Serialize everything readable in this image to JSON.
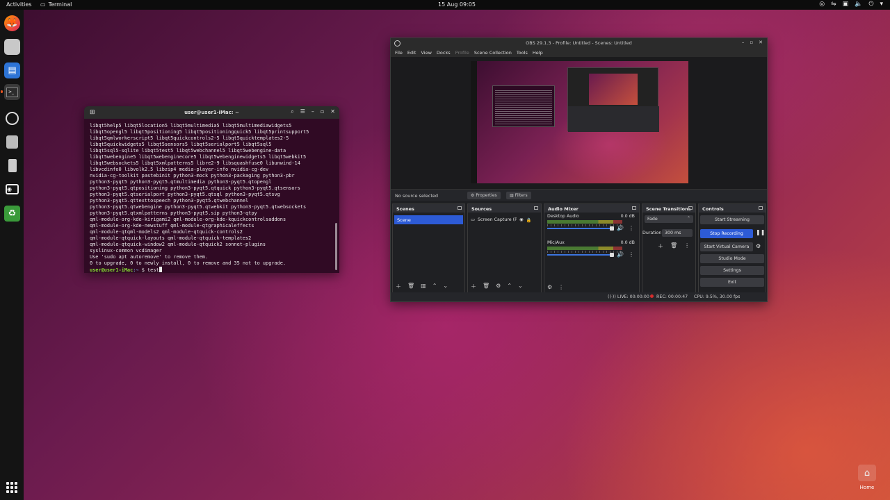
{
  "topbar": {
    "activities": "Activities",
    "app_name": "Terminal",
    "clock": "15 Aug 09:05"
  },
  "dock": {
    "items": [
      "firefox-icon",
      "files-icon",
      "text-editor-icon",
      "terminal-icon",
      "obs-icon",
      "disk-icon",
      "usb-drive-icon",
      "screenshot-icon",
      "trash-icon",
      "show-apps-icon"
    ]
  },
  "terminal": {
    "title": "user@user1-iMac: ~",
    "lines": [
      "libqt5help5 libqt5location5 libqt5multimedia5 libqt5multimediawidgets5",
      "libqt5opengl5 libqt5positioning5 libqt5positioningquick5 libqt5printsupport5",
      "libqt5qmlworkerscript5 libqt5quickcontrols2-5 libqt5quicktemplates2-5",
      "libqt5quickwidgets5 libqt5sensors5 libqt5serialport5 libqt5sql5",
      "libqt5sql5-sqlite libqt5test5 libqt5webchannel5 libqt5webengine-data",
      "libqt5webengine5 libqt5webenginecore5 libqt5webenginewidgets5 libqt5webkit5",
      "libqt5websockets5 libqt5xmlpatterns5 libre2-9 libsquashfuse0 libunwind-14",
      "libvcdinfo0 libvolk2.5 libzip4 media-player-info nvidia-cg-dev",
      "nvidia-cg-toolkit pastebinit python3-mock python3-packaging python3-pbr",
      "python3-pyqt5 python3-pyqt5.qtmultimedia python3-pyqt5.qtopengl",
      "python3-pyqt5.qtpositioning python3-pyqt5.qtquick python3-pyqt5.qtsensors",
      "python3-pyqt5.qtserialport python3-pyqt5.qtsql python3-pyqt5.qtsvg",
      "python3-pyqt5.qttexttospeech python3-pyqt5.qtwebchannel",
      "python3-pyqt5.qtwebengine python3-pyqt5.qtwebkit python3-pyqt5.qtwebsockets",
      "python3-pyqt5.qtxmlpatterns python3-pyqt5.sip python3-qtpy",
      "qml-module-org-kde-kirigami2 qml-module-org-kde-kquickcontrolsaddons",
      "qml-module-org-kde-newstuff qml-module-qtgraphicaleffects",
      "qml-module-qtqml-models2 qml-module-qtquick-controls2",
      "qml-module-qtquick-layouts qml-module-qtquick-templates2",
      "qml-module-qtquick-window2 qml-module-qtquick2 sonnet-plugins",
      "syslinux-common vcdimager",
      "Use 'sudo apt autoremove' to remove them.",
      "0 to upgrade, 0 to newly install, 0 to remove and 35 not to upgrade."
    ],
    "prompt_user": "user@user1-iMac",
    "prompt_path": ":~",
    "prompt_symbol": "$",
    "current_input": "test"
  },
  "obs": {
    "title": "OBS 29.1.3 - Profile: Untitled - Scenes: Untitled",
    "menu": [
      "File",
      "Edit",
      "View",
      "Docks",
      "Profile",
      "Scene Collection",
      "Tools",
      "Help"
    ],
    "source_bar": {
      "no_source": "No source selected",
      "properties": "Properties",
      "filters": "Filters"
    },
    "scenes": {
      "title": "Scenes",
      "items": [
        "Scene"
      ]
    },
    "sources": {
      "title": "Sources",
      "items": [
        "Screen Capture (PipeWire)"
      ]
    },
    "mixer": {
      "title": "Audio Mixer",
      "channels": [
        {
          "name": "Desktop Audio",
          "db": "0.0 dB"
        },
        {
          "name": "Mic/Aux",
          "db": "0.0 dB"
        }
      ]
    },
    "transitions": {
      "title": "Scene Transitions",
      "selected": "Fade",
      "duration_label": "Duration",
      "duration": "300 ms"
    },
    "controls": {
      "title": "Controls",
      "start_streaming": "Start Streaming",
      "stop_recording": "Stop Recording",
      "start_virtual_camera": "Start Virtual Camera",
      "studio_mode": "Studio Mode",
      "settings": "Settings",
      "exit": "Exit"
    },
    "status": {
      "live": "LIVE: 00:00:00",
      "rec": "REC: 00:00:47",
      "cpu": "CPU: 9.5%, 30.00 fps"
    }
  },
  "desktop": {
    "home_label": "Home"
  },
  "colors": {
    "accent": "#2d5bd6",
    "ubuntu_orange": "#e95420",
    "terminal_bg": "#300a24"
  }
}
